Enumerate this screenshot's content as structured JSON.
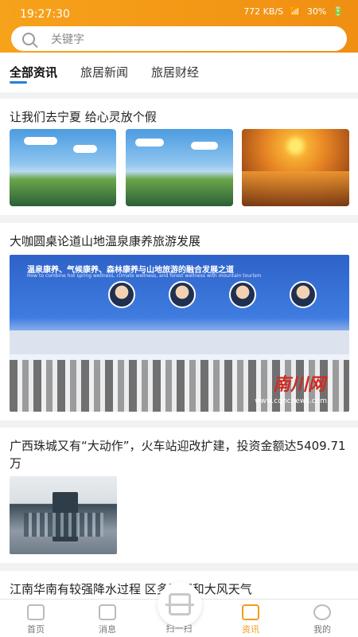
{
  "status": {
    "time": "19:27:30",
    "network_speed": "772 KB/S",
    "battery": "30%"
  },
  "search": {
    "placeholder": "关键字"
  },
  "tabs": [
    {
      "label": "全部资讯",
      "active": true
    },
    {
      "label": "旅居新闻",
      "active": false
    },
    {
      "label": "旅居财经",
      "active": false
    }
  ],
  "articles": [
    {
      "title": "让我们去宁夏 给心灵放个假"
    },
    {
      "title": "大咖圆桌论道山地温泉康养旅游发展",
      "image_text": {
        "headline": "温泉康养、气候康养、森林康养与山地旅游的融合发展之道",
        "subheadline": "How to combine hot spring wellness, climate wellness, and forest wellness with mountain tourism",
        "watermark": "南川网",
        "watermark_url": "www.cqncnews.com"
      }
    },
    {
      "title": "广西珠城又有“大动作”，火车站迎改扩建，投资金额达5409.71万"
    },
    {
      "title": "江南华南有较强降水过程 区多阵雨和大风天气"
    }
  ],
  "bottom_nav": [
    {
      "label": "首页",
      "icon": "home-icon",
      "active": false
    },
    {
      "label": "消息",
      "icon": "bell-icon",
      "active": false
    },
    {
      "label": "扫一扫",
      "icon": "scan-icon",
      "active": false
    },
    {
      "label": "资讯",
      "icon": "news-icon",
      "active": true
    },
    {
      "label": "我的",
      "icon": "user-icon",
      "active": false
    }
  ],
  "colors": {
    "accent": "#f39b1a",
    "tab_indicator": "#2a7de1"
  }
}
